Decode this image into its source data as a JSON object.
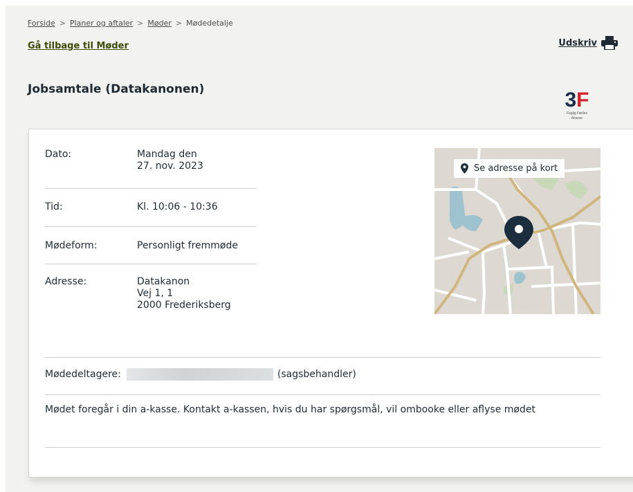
{
  "breadcrumb": {
    "items": [
      "Forside",
      "Planer og aftaler",
      "Møder"
    ],
    "current": "Mødedetalje",
    "separator": ">"
  },
  "back_link": "Gå tilbage til Møder",
  "print": {
    "label": "Udskriv",
    "icon": "printer-icon"
  },
  "page_title": "Jobsamtale (Datakanonen)",
  "logo": {
    "mark": "3F",
    "line1": "Faglig Fælles",
    "line2": "Akasse"
  },
  "details": {
    "date_label": "Dato:",
    "date_line1": "Mandag den",
    "date_line2": "27. nov. 2023",
    "time_label": "Tid:",
    "time_value": "Kl. 10:06 - 10:36",
    "form_label": "Mødeform:",
    "form_value": "Personligt fremmøde",
    "address_label": "Adresse:",
    "address_line1": "Datakanon",
    "address_line2": "Vej 1, 1",
    "address_line3": "2000 Frederiksberg"
  },
  "map": {
    "button_label": "Se adresse på kort",
    "icon": "map-pin-icon"
  },
  "participants": {
    "label": "Mødedeltagere:",
    "role": "(sagsbehandler)"
  },
  "note": "Mødet foregår i din a-kasse. Kontakt a-kassen, hvis du har spørgsmål, vil ombooke eller aflyse mødet",
  "colors": {
    "link_green": "#3d4a08",
    "text": "#1f2a33",
    "logo_red": "#d6202a",
    "logo_navy": "#1a2b4a"
  }
}
